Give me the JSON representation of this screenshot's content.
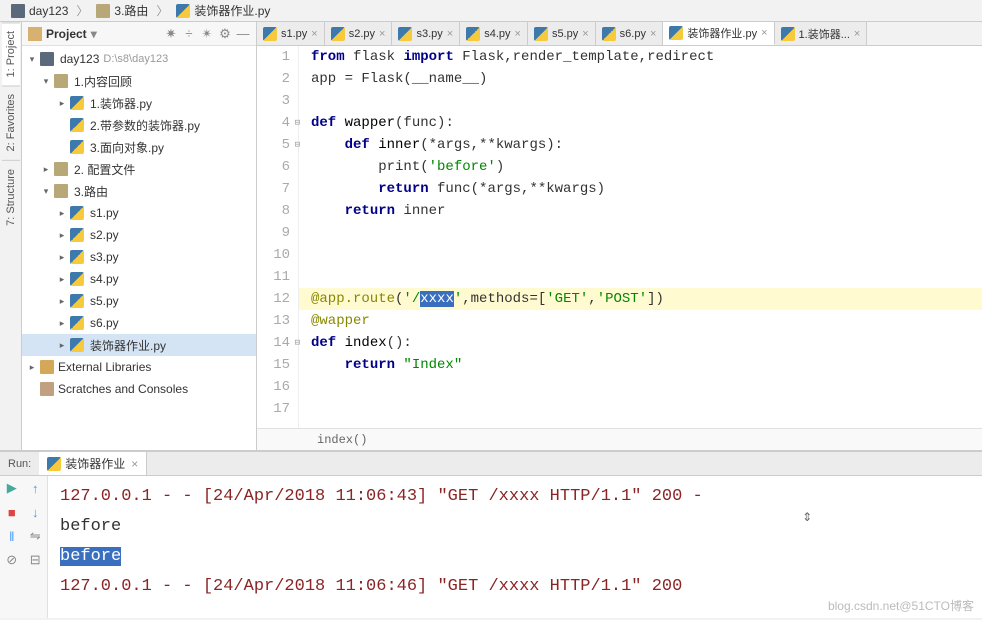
{
  "breadcrumb": [
    {
      "icon": "folder-dark",
      "label": "day123"
    },
    {
      "icon": "folder",
      "label": "3.路由"
    },
    {
      "icon": "py",
      "label": "装饰器作业.py"
    }
  ],
  "left_sidebar_tabs": {
    "project": "1: Project",
    "favorites": "2: Favorites",
    "structure": "7: Structure"
  },
  "project_panel": {
    "title": "Project",
    "dropdown": "▾",
    "toolbar_icons": [
      "✷",
      "÷",
      "✴",
      "⚙",
      "—"
    ]
  },
  "tree": [
    {
      "depth": 0,
      "arrow": "▾",
      "icon": "folder-dark",
      "label": "day123",
      "path": "D:\\s8\\day123"
    },
    {
      "depth": 1,
      "arrow": "▾",
      "icon": "folder",
      "label": "1.内容回顾"
    },
    {
      "depth": 2,
      "arrow": "▸",
      "icon": "py",
      "label": "1.装饰器.py"
    },
    {
      "depth": 2,
      "arrow": " ",
      "icon": "py",
      "label": "2.带参数的装饰器.py"
    },
    {
      "depth": 2,
      "arrow": " ",
      "icon": "py",
      "label": "3.面向对象.py"
    },
    {
      "depth": 1,
      "arrow": "▸",
      "icon": "folder",
      "label": "2. 配置文件"
    },
    {
      "depth": 1,
      "arrow": "▾",
      "icon": "folder",
      "label": "3.路由"
    },
    {
      "depth": 2,
      "arrow": "▸",
      "icon": "py",
      "label": "s1.py"
    },
    {
      "depth": 2,
      "arrow": "▸",
      "icon": "py",
      "label": "s2.py"
    },
    {
      "depth": 2,
      "arrow": "▸",
      "icon": "py",
      "label": "s3.py"
    },
    {
      "depth": 2,
      "arrow": "▸",
      "icon": "py",
      "label": "s4.py"
    },
    {
      "depth": 2,
      "arrow": "▸",
      "icon": "py",
      "label": "s5.py"
    },
    {
      "depth": 2,
      "arrow": "▸",
      "icon": "py",
      "label": "s6.py"
    },
    {
      "depth": 2,
      "arrow": "▸",
      "icon": "py",
      "label": "装饰器作业.py",
      "selected": true
    },
    {
      "depth": 0,
      "arrow": "▸",
      "icon": "lib",
      "label": "External Libraries"
    },
    {
      "depth": 0,
      "arrow": " ",
      "icon": "scratch",
      "label": "Scratches and Consoles"
    }
  ],
  "tabs": [
    {
      "label": "s1.py"
    },
    {
      "label": "s2.py"
    },
    {
      "label": "s3.py"
    },
    {
      "label": "s4.py"
    },
    {
      "label": "s5.py"
    },
    {
      "label": "s6.py"
    },
    {
      "label": "装饰器作业.py",
      "active": true
    },
    {
      "label": "1.装饰器..."
    }
  ],
  "code_lines": [
    {
      "n": 1,
      "segs": [
        {
          "t": "from ",
          "c": "kw"
        },
        {
          "t": "flask ",
          "c": ""
        },
        {
          "t": "import ",
          "c": "kw"
        },
        {
          "t": "Flask,render_template,redirect",
          "c": ""
        }
      ]
    },
    {
      "n": 2,
      "segs": [
        {
          "t": "app = Flask(__name__)",
          "c": ""
        }
      ]
    },
    {
      "n": 3,
      "segs": []
    },
    {
      "n": 4,
      "fold": "⊟",
      "segs": [
        {
          "t": "def ",
          "c": "kw"
        },
        {
          "t": "wapper",
          "c": "fn"
        },
        {
          "t": "(func):",
          "c": ""
        }
      ]
    },
    {
      "n": 5,
      "fold": "⊟",
      "segs": [
        {
          "t": "    ",
          "c": ""
        },
        {
          "t": "def ",
          "c": "kw"
        },
        {
          "t": "inner",
          "c": "fn"
        },
        {
          "t": "(*args,**kwargs):",
          "c": ""
        }
      ]
    },
    {
      "n": 6,
      "segs": [
        {
          "t": "        print(",
          "c": ""
        },
        {
          "t": "'before'",
          "c": "str"
        },
        {
          "t": ")",
          "c": ""
        }
      ]
    },
    {
      "n": 7,
      "segs": [
        {
          "t": "        ",
          "c": ""
        },
        {
          "t": "return ",
          "c": "kw"
        },
        {
          "t": "func(*args,**kwargs)",
          "c": ""
        }
      ]
    },
    {
      "n": 8,
      "segs": [
        {
          "t": "    ",
          "c": ""
        },
        {
          "t": "return ",
          "c": "kw"
        },
        {
          "t": "inner",
          "c": ""
        }
      ]
    },
    {
      "n": 9,
      "segs": []
    },
    {
      "n": 10,
      "segs": []
    },
    {
      "n": 11,
      "segs": []
    },
    {
      "n": 12,
      "hl": true,
      "segs": [
        {
          "t": "@app.route",
          "c": "dec"
        },
        {
          "t": "(",
          "c": ""
        },
        {
          "t": "'/",
          "c": "str"
        },
        {
          "t": "xxxx",
          "c": "sel"
        },
        {
          "t": "'",
          "c": "str"
        },
        {
          "t": ",methods=[",
          "c": ""
        },
        {
          "t": "'GET'",
          "c": "str"
        },
        {
          "t": ",",
          "c": ""
        },
        {
          "t": "'POST'",
          "c": "str"
        },
        {
          "t": "])",
          "c": ""
        }
      ]
    },
    {
      "n": 13,
      "segs": [
        {
          "t": "@wapper",
          "c": "dec"
        }
      ]
    },
    {
      "n": 14,
      "fold": "⊟",
      "segs": [
        {
          "t": "def ",
          "c": "kw"
        },
        {
          "t": "index",
          "c": "fn"
        },
        {
          "t": "():",
          "c": ""
        }
      ]
    },
    {
      "n": 15,
      "segs": [
        {
          "t": "    ",
          "c": ""
        },
        {
          "t": "return ",
          "c": "kw"
        },
        {
          "t": "\"Index\"",
          "c": "str"
        }
      ]
    },
    {
      "n": 16,
      "segs": []
    },
    {
      "n": 17,
      "segs": []
    }
  ],
  "editor_crumb": "index()",
  "run": {
    "label": "Run:",
    "tab": "装饰器作业",
    "toolbar": [
      "▶",
      "↑",
      "■",
      "↓",
      "‖",
      "⇋",
      "⊘",
      "⊟"
    ]
  },
  "console": [
    {
      "cls": "http",
      "text": "127.0.0.1 - - [24/Apr/2018 11:06:43] \"GET /xxxx HTTP/1.1\" 200 -"
    },
    {
      "cls": "plain",
      "text": "before"
    },
    {
      "cls": "plain",
      "text": "before",
      "selected": true
    },
    {
      "cls": "http",
      "text": "127.0.0.1 - - [24/Apr/2018 11:06:46] \"GET /xxxx HTTP/1.1\" 200"
    }
  ],
  "watermark": "blog.csdn.net@51CTO博客"
}
